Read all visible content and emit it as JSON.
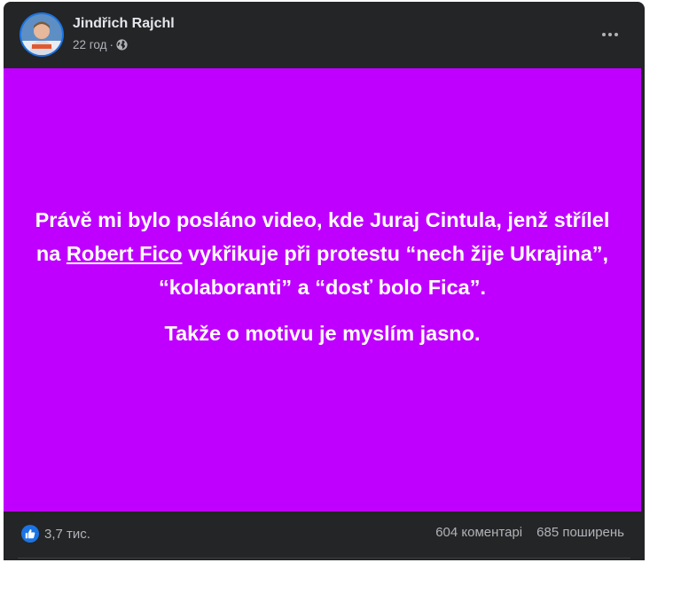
{
  "post": {
    "author": "Jindřich Rajchl",
    "time": "22 год",
    "separator": "·",
    "privacy_icon": "globe-icon",
    "more_icon": "more-horizontal-icon",
    "background_color": "#bf00ff",
    "text": {
      "line_before_mention": "Právě mi bylo posláno video, kde Juraj Cintula, jenž střílel na ",
      "mention": "Robert Fico",
      "line_after_mention": " vykřikuje při protestu “nech žije Ukrajina”, “kolaboranti” a “dosť bolo Fica”.",
      "second_paragraph": "Takže o motivu je myslím jasno."
    }
  },
  "footer": {
    "reaction_icon": "like-icon",
    "reaction_count": "3,7 тис.",
    "comments": "604 коментарі",
    "shares": "685 поширень"
  }
}
